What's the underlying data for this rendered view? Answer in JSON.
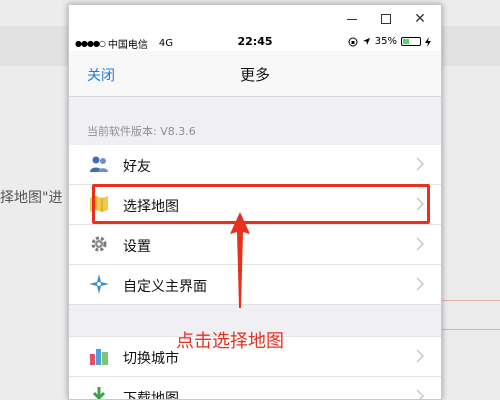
{
  "background": {
    "left_text": "择地图\"进"
  },
  "window": {
    "min_label": "",
    "max_label": "",
    "close_label": "✕"
  },
  "status": {
    "carrier": "中国电信",
    "network": "4G",
    "time": "22:45",
    "battery": "35%",
    "battery_level": 0.35
  },
  "navbar": {
    "close": "关闭",
    "title": "更多"
  },
  "version_label": "当前软件版本: V8.3.6",
  "menu": [
    {
      "label": "好友",
      "icon": "friends-icon"
    },
    {
      "label": "选择地图",
      "icon": "map-select-icon"
    },
    {
      "label": "设置",
      "icon": "gear-icon"
    },
    {
      "label": "自定义主界面",
      "icon": "custom-home-icon"
    }
  ],
  "menu2": [
    {
      "label": "切换城市",
      "icon": "city-icon"
    },
    {
      "label": "下载地图",
      "icon": "download-icon"
    }
  ],
  "annotation": {
    "text": "点击选择地图",
    "color": "#e8301f"
  },
  "colors": {
    "accent": "#1f7ae0",
    "highlight": "#e8301f"
  }
}
